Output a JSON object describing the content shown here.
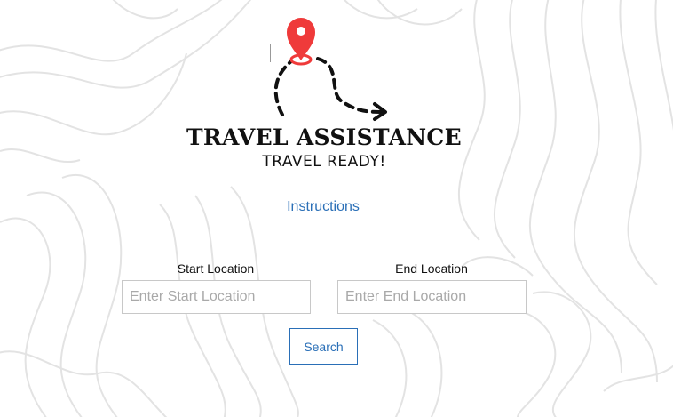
{
  "logo": {
    "title": "TRAVEL ASSISTANCE",
    "subtitle": "TRAVEL READY!",
    "pin_color": "#ef3a3a"
  },
  "instructions": {
    "label": "Instructions"
  },
  "form": {
    "start": {
      "label": "Start Location",
      "placeholder": "Enter Start Location",
      "value": ""
    },
    "end": {
      "label": "End Location",
      "placeholder": "Enter End Location",
      "value": ""
    },
    "search_label": "Search"
  },
  "colors": {
    "link": "#2a6fb7",
    "contour": "#e6e6e6",
    "text": "#111111"
  }
}
